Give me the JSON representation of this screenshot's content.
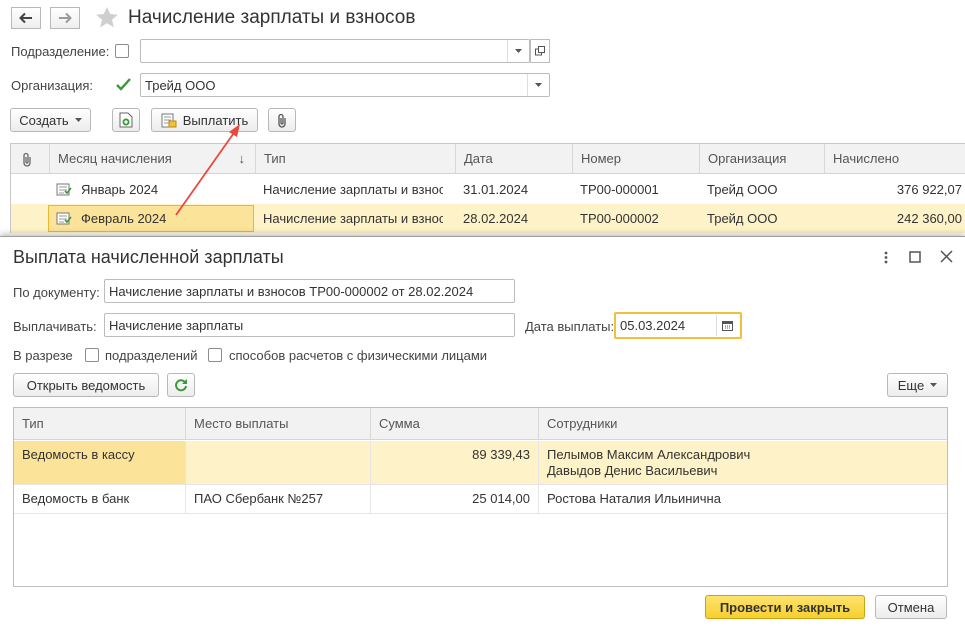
{
  "header": {
    "title": "Начисление зарплаты и взносов",
    "back_icon": "arrow-left-icon",
    "forward_icon": "arrow-right-icon",
    "favorite_icon": "star-icon"
  },
  "filters": {
    "department_label": "Подразделение:",
    "department_value": "",
    "organization_label": "Организация:",
    "organization_value": "Трейд ООО"
  },
  "toolbar": {
    "create_label": "Создать",
    "pay_label": "Выплатить"
  },
  "list": {
    "columns": [
      "Месяц начисления",
      "Тип",
      "Дата",
      "Номер",
      "Организация",
      "Начислено"
    ],
    "sort_indicator": "↓",
    "rows": [
      {
        "month": "Январь 2024",
        "type": "Начисление зарплаты и взносов",
        "date": "31.01.2024",
        "number": "ТР00-000001",
        "org": "Трейд ООО",
        "amount": "376 922,07"
      },
      {
        "month": "Февраль 2024",
        "type": "Начисление зарплаты и взносов",
        "date": "28.02.2024",
        "number": "ТР00-000002",
        "org": "Трейд ООО",
        "amount": "242 360,00"
      }
    ]
  },
  "dialog": {
    "title": "Выплата начисленной зарплаты",
    "doc_label": "По документу:",
    "doc_value": "Начисление зарплаты и взносов ТР00-000002 от 28.02.2024",
    "pay_label": "Выплачивать:",
    "pay_value": "Начисление зарплаты",
    "date_label": "Дата выплаты:",
    "date_value": "05.03.2024",
    "breakdown_label": "В разрезе",
    "by_department_label": "подразделений",
    "by_method_label": "способов расчетов с физическими лицами",
    "open_sheet_label": "Открыть ведомость",
    "more_label": "Еще",
    "columns": [
      "Тип",
      "Место выплаты",
      "Сумма",
      "Сотрудники"
    ],
    "rows": [
      {
        "type": "Ведомость в кассу",
        "place": "",
        "sum": "89 339,43",
        "employees": [
          "Пелымов Максим Александрович",
          "Давыдов Денис Васильевич"
        ]
      },
      {
        "type": "Ведомость в банк",
        "place": "ПАО Сбербанк №257",
        "sum": "25 014,00",
        "employees": [
          "Ростова Наталия Ильинична"
        ]
      }
    ],
    "post_close_label": "Провести и закрыть",
    "cancel_label": "Отмена"
  },
  "colors": {
    "accent_yellow": "#fbe39a",
    "selection_yellow": "#fef2c8",
    "primary_button": "#fad333",
    "annotation_arrow": "#e8483d",
    "checkbox_green": "#3a9a3a"
  }
}
